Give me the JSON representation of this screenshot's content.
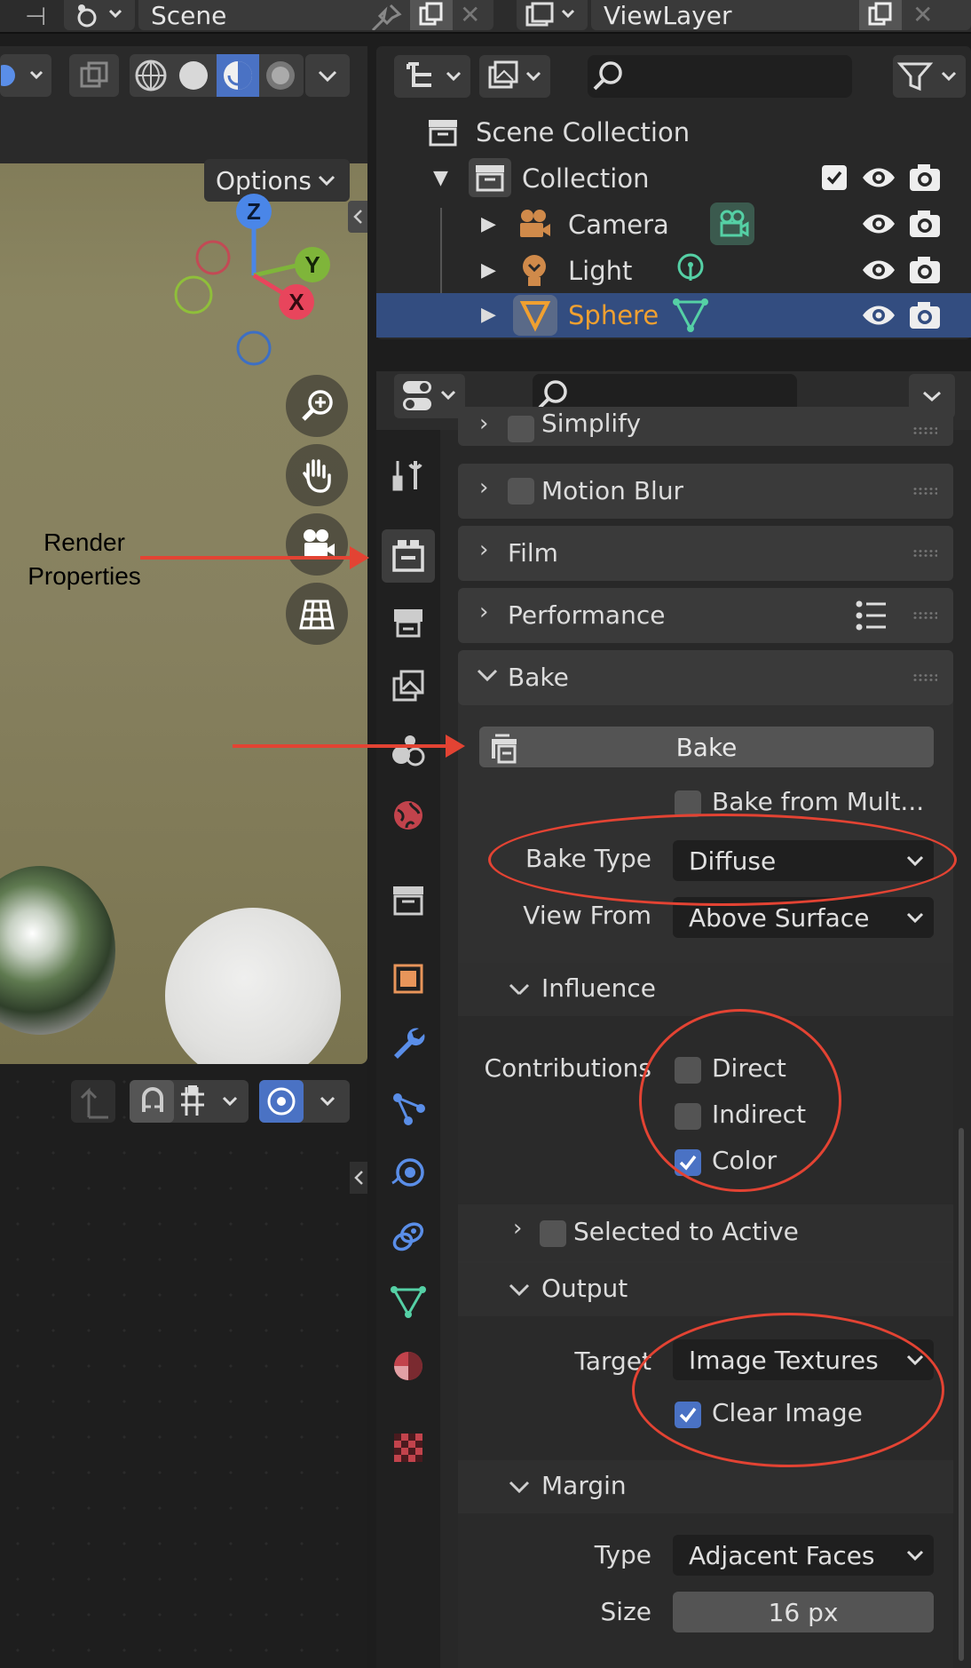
{
  "header": {
    "scene_name": "Scene",
    "view_layer_name": "ViewLayer"
  },
  "viewport": {
    "options_label": "Options",
    "gizmo_axes": [
      "Z",
      "Y",
      "X"
    ],
    "annotation": {
      "line1": "Render",
      "line2": "Properties"
    }
  },
  "outliner": {
    "root": "Scene Collection",
    "collection": "Collection",
    "objects": [
      {
        "name": "Camera",
        "icon": "camera-icon"
      },
      {
        "name": "Light",
        "icon": "light-icon"
      },
      {
        "name": "Sphere",
        "icon": "mesh-icon",
        "selected": true
      }
    ],
    "selected_color": "#f0a030",
    "selection_bg": "#334d80"
  },
  "properties": {
    "panels": {
      "simplify": "Simplify",
      "motion_blur": "Motion Blur",
      "film": "Film",
      "performance": "Performance",
      "bake": "Bake"
    },
    "bake": {
      "button_label": "Bake",
      "bake_from_multires": "Bake from Mult...",
      "bake_type_label": "Bake Type",
      "bake_type_value": "Diffuse",
      "view_from_label": "View From",
      "view_from_value": "Above Surface",
      "influence_label": "Influence",
      "contributions_label": "Contributions",
      "direct": {
        "label": "Direct",
        "checked": false
      },
      "indirect": {
        "label": "Indirect",
        "checked": false
      },
      "color": {
        "label": "Color",
        "checked": true
      },
      "selected_to_active": "Selected to Active",
      "output_label": "Output",
      "target_label": "Target",
      "target_value": "Image Textures",
      "clear_image": {
        "label": "Clear Image",
        "checked": true
      },
      "margin_label": "Margin",
      "margin_type_label": "Type",
      "margin_type_value": "Adjacent Faces",
      "margin_size_label": "Size",
      "margin_size_value": "16 px"
    }
  },
  "colors": {
    "annotation_red": "#e34333",
    "checkbox_blue": "#4a72c4"
  }
}
